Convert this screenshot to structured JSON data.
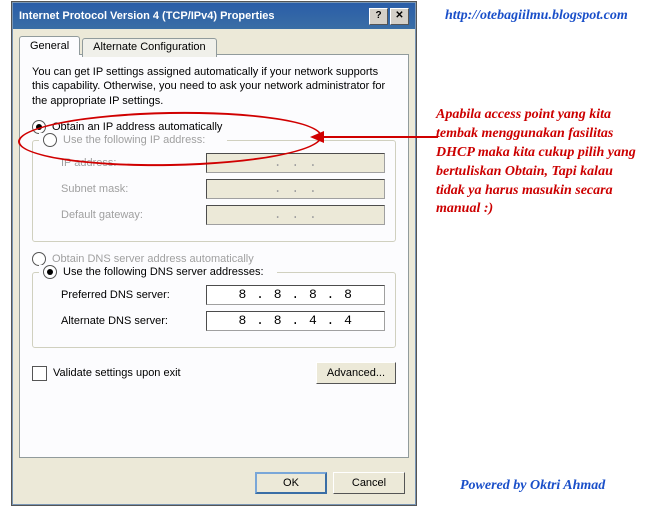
{
  "window": {
    "title": "Internet Protocol Version 4 (TCP/IPv4) Properties",
    "help_btn": "?",
    "close_btn": "✕"
  },
  "tabs": {
    "general": "General",
    "alt": "Alternate Configuration"
  },
  "description": "You can get IP settings assigned automatically if your network supports this capability. Otherwise, you need to ask your network administrator for the appropriate IP settings.",
  "ip_section": {
    "auto_label": "Obtain an IP address automatically",
    "manual_label": "Use the following IP address:",
    "fields": {
      "ip_label": "IP address:",
      "subnet_label": "Subnet mask:",
      "gateway_label": "Default gateway:",
      "ip_value": "",
      "subnet_value": "",
      "gateway_value": ""
    }
  },
  "dns_section": {
    "auto_label": "Obtain DNS server address automatically",
    "manual_label": "Use the following DNS server addresses:",
    "fields": {
      "pref_label": "Preferred DNS server:",
      "alt_label": "Alternate DNS server:",
      "pref_value": "8 . 8 . 8 . 8",
      "alt_value": "8 . 8 . 4 . 4"
    }
  },
  "validate_label": "Validate settings upon exit",
  "advanced_btn": "Advanced...",
  "ok_btn": "OK",
  "cancel_btn": "Cancel",
  "annotation": {
    "url": "http://otebagiilmu.blogspot.com",
    "note": "Apabila access point yang kita tembak menggunakan fasilitas DHCP maka kita cukup pilih yang bertuliskan Obtain, Tapi kalau tidak ya harus masukin secara manual :)",
    "powered": "Powered by Oktri Ahmad"
  }
}
